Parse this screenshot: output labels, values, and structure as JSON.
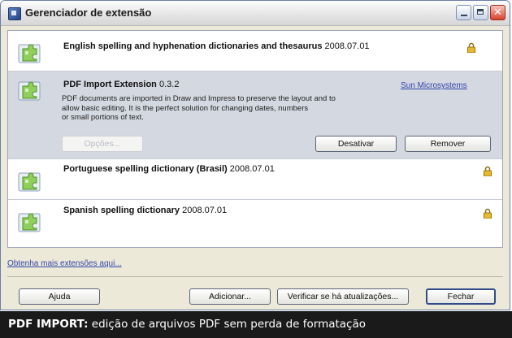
{
  "window": {
    "title": "Gerenciador de extensão"
  },
  "extensions": [
    {
      "name": "English spelling and hyphenation dictionaries and thesaurus",
      "version": "2008.07.01"
    },
    {
      "name": "PDF Import Extension",
      "version": "0.3.2",
      "publisher": "Sun Microsystems",
      "description": [
        "PDF documents are imported in Draw and Impress to preserve the layout and to",
        "allow basic editing. It is the perfect solution for changing dates, numbers",
        "or small portions of text."
      ],
      "options_label": "Opções...",
      "disable_label": "Desativar",
      "remove_label": "Remover"
    },
    {
      "name": "Portuguese spelling dictionary (Brasil)",
      "version": "2008.07.01"
    },
    {
      "name": "Spanish spelling dictionary",
      "version": "2008.07.01"
    }
  ],
  "more_link": "Obtenha mais extensões aqui...",
  "footer": {
    "help": "Ajuda",
    "add": "Adicionar...",
    "check_updates": "Verificar se há atualizações...",
    "close": "Fechar"
  },
  "caption": {
    "lead": "PDF IMPORT:",
    "text": " edição de arquivos PDF sem perda de formatação"
  },
  "colors": {
    "selected_row": "#d4d8e1",
    "link": "#3344aa",
    "caption_bg": "#1a1a1a"
  }
}
